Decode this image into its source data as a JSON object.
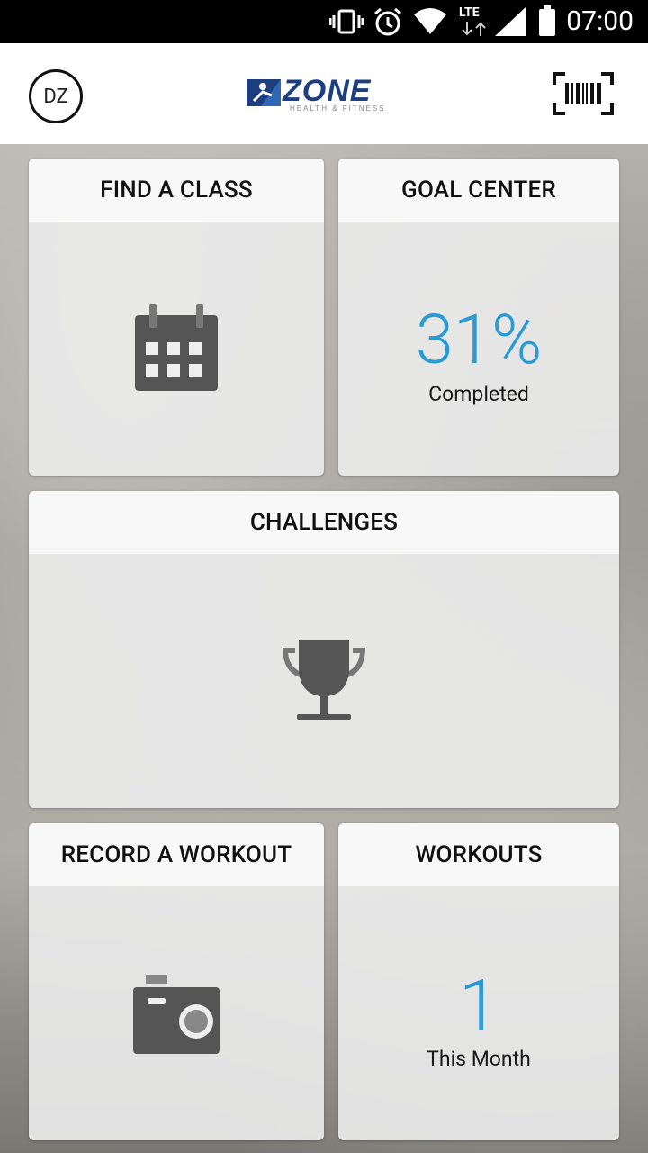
{
  "status_bar": {
    "time": "07:00",
    "network": "LTE"
  },
  "header": {
    "avatar_initials": "DZ",
    "logo_text": "ZONE",
    "logo_tagline": "HEALTH & FITNESS"
  },
  "cards": {
    "find_class": {
      "title": "FIND A CLASS",
      "icon": "calendar-icon"
    },
    "goal_center": {
      "title": "GOAL CENTER",
      "percent": "31%",
      "caption": "Completed"
    },
    "challenges": {
      "title": "CHALLENGES",
      "icon": "trophy-icon"
    },
    "record_workout": {
      "title": "RECORD A WORKOUT",
      "icon": "camera-icon"
    },
    "workouts": {
      "title": "WORKOUTS",
      "count": "1",
      "caption": "This Month"
    }
  },
  "colors": {
    "accent": "#2a9ad6",
    "icon_gray": "#555555"
  }
}
